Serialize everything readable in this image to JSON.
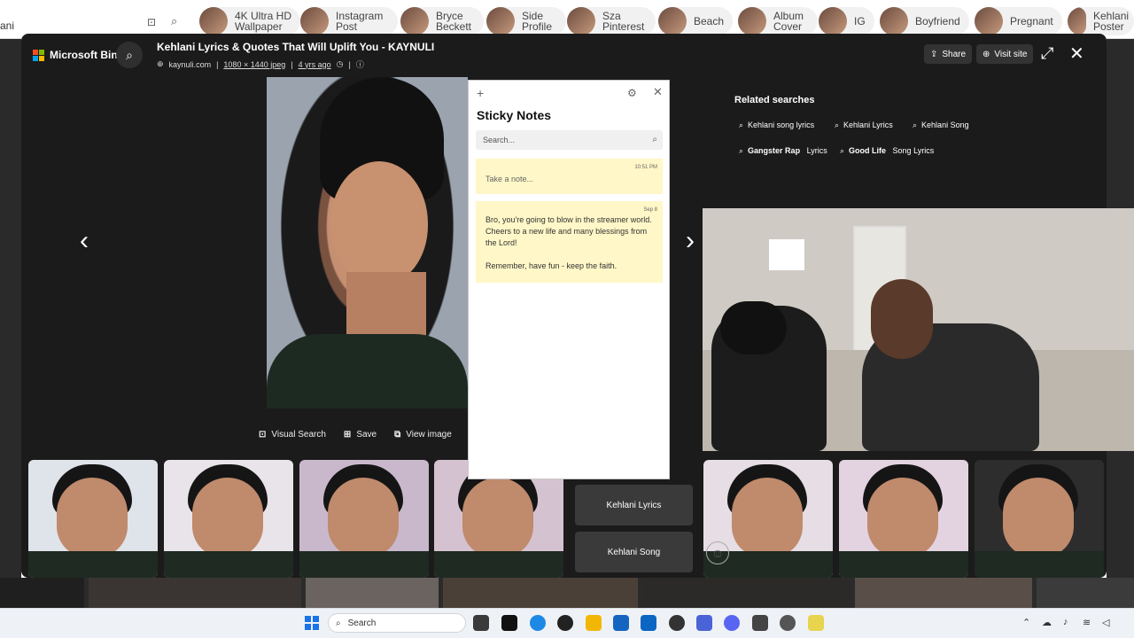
{
  "top_strip": {
    "left_text": "ani",
    "chips": [
      "4K Ultra HD Wallpaper",
      "Instagram Post",
      "Bryce Beckett",
      "Side Profile",
      "Sza Pinterest",
      "Beach",
      "Album Cover",
      "IG",
      "Boyfriend",
      "Pregnant",
      "Kehlani Poster"
    ]
  },
  "viewer": {
    "brand": "Microsoft Bing",
    "title": "Kehlani Lyrics & Quotes That Will Uplift You - KAYNULI",
    "source": "kaynuli.com",
    "dimensions": "1080 × 1440 jpeg",
    "age": "4 yrs ago",
    "share_label": "Share",
    "visit_label": "Visit site",
    "actions": [
      "Visual Search",
      "Save",
      "View image"
    ]
  },
  "related": {
    "title": "Related searches",
    "items": [
      {
        "pre": "",
        "bold": "",
        "post": "Kehlani song lyrics"
      },
      {
        "pre": "",
        "bold": "",
        "post": "Kehlani Lyrics"
      },
      {
        "pre": "",
        "bold": "",
        "post": "Kehlani Song"
      },
      {
        "pre": "",
        "bold": "Gangster Rap",
        "post": " Lyrics"
      },
      {
        "pre": "",
        "bold": "Good Life",
        "post": " Song Lyrics"
      }
    ]
  },
  "thumb_tags": [
    "Kehlani Lyrics",
    "Kehlani Song"
  ],
  "sticky_notes": {
    "title": "Sticky Notes",
    "search_placeholder": "Search...",
    "notes": [
      {
        "date": "10:51 PM",
        "text": "Take a note..."
      },
      {
        "date": "Sep 8",
        "text": "Bro, you're going to blow in the streamer world. Cheers to a new life and many blessings from the Lord!",
        "text2": "Remember, have fun - keep the faith."
      }
    ]
  },
  "taskbar": {
    "search_label": "Search"
  },
  "colors": {
    "overlay_bg": "#1b1b1b",
    "sticky_note": "#fff7c7",
    "taskbar": "#eef2f7"
  }
}
